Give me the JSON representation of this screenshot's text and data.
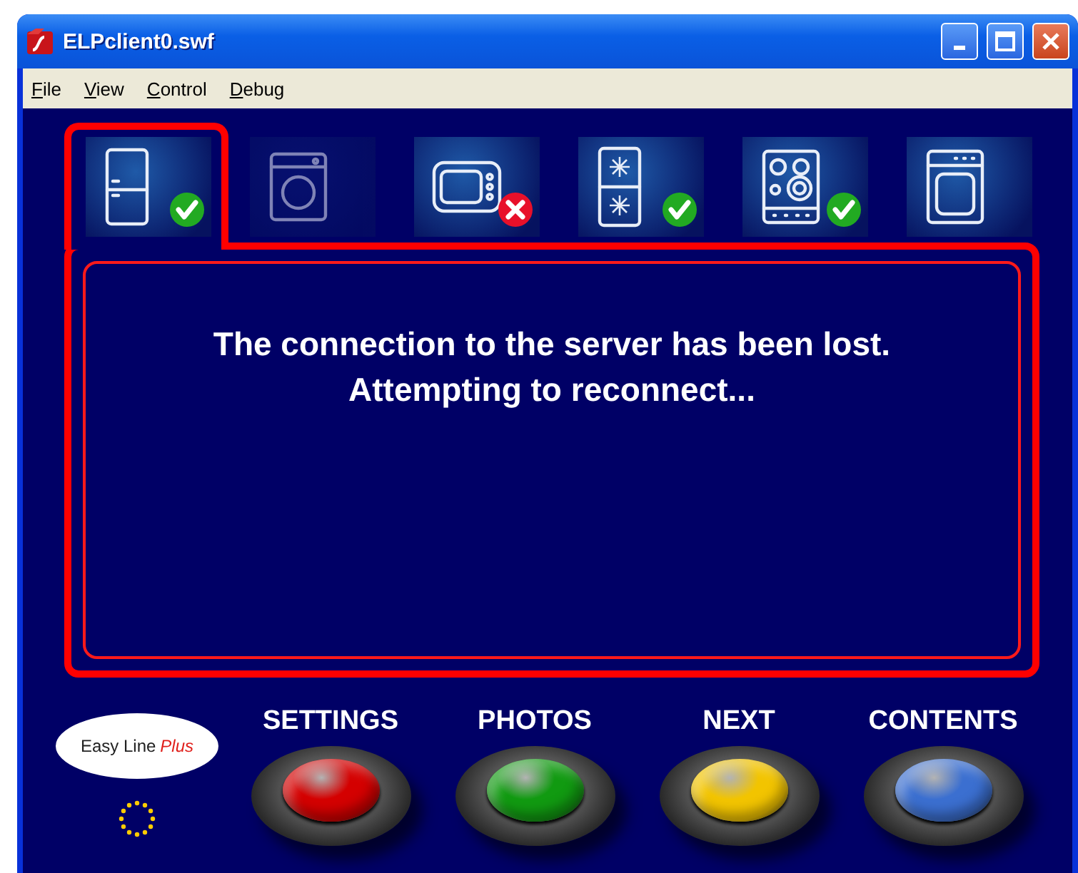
{
  "window": {
    "title": "ELPclient0.swf"
  },
  "menu": [
    "File",
    "View",
    "Control",
    "Debug"
  ],
  "appliances": [
    {
      "kind": "fridge",
      "selected": true,
      "disabled": false,
      "ok": true,
      "fault": false
    },
    {
      "kind": "washer",
      "selected": false,
      "disabled": true,
      "ok": false,
      "fault": false
    },
    {
      "kind": "microwave",
      "selected": false,
      "disabled": false,
      "ok": false,
      "fault": true
    },
    {
      "kind": "freezer",
      "selected": false,
      "disabled": false,
      "ok": true,
      "fault": false
    },
    {
      "kind": "hob",
      "selected": false,
      "disabled": false,
      "ok": true,
      "fault": false
    },
    {
      "kind": "oven",
      "selected": false,
      "disabled": false,
      "ok": false,
      "fault": false
    }
  ],
  "message": [
    "The connection to the server has been lost.",
    "Attempting to reconnect..."
  ],
  "logo": {
    "text": "Easy Line",
    "accent": "Plus"
  },
  "buttons": [
    {
      "label": "SETTINGS",
      "color": "#d40000"
    },
    {
      "label": "PHOTOS",
      "color": "#119a11"
    },
    {
      "label": "NEXT",
      "color": "#f2c400"
    },
    {
      "label": "CONTENTS",
      "color": "#3b6fd0"
    }
  ]
}
